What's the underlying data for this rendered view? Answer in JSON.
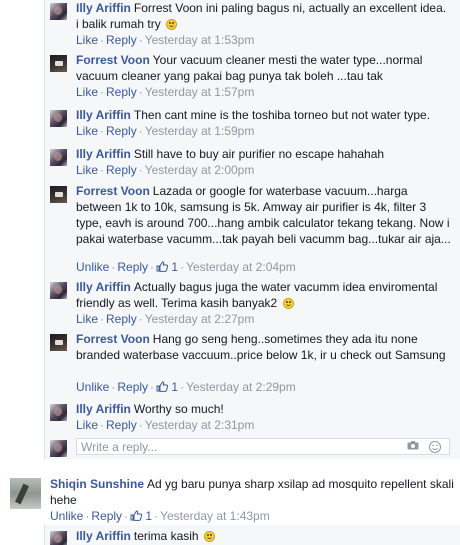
{
  "labels": {
    "like": "Like",
    "unlike": "Unlike",
    "reply": "Reply",
    "sep": "·",
    "write_placeholder": "Write a reply..."
  },
  "replies": [
    {
      "author": "Illy Ariffin",
      "text": "Forrest Voon ini paling bagus ni, actually an excellent idea. i balik rumah try",
      "emoji": "smile",
      "action": "Like",
      "likes": "",
      "time": "Yesterday at 1:53pm"
    },
    {
      "author": "Forrest Voon",
      "text": "Your vacuum cleaner mesti the water type...normal vacuum cleaner yang pakai bag punya tak boleh ...tau tak",
      "action": "Like",
      "likes": "",
      "time": "Yesterday at 1:57pm"
    },
    {
      "author": "Illy Ariffin",
      "text": "Then cant mine is the toshiba torneo but not water type.",
      "action": "Like",
      "likes": "",
      "time": "Yesterday at 1:59pm"
    },
    {
      "author": "Illy Ariffin",
      "text": "Still have to buy air purifier no escape hahahah",
      "action": "Like",
      "likes": "",
      "time": "Yesterday at 2:00pm"
    },
    {
      "author": "Forrest Voon",
      "text": "Lazada or google for waterbase vacuum...harga between 1k to 10k, samsung is 5k. Amway air purifier is 4k, filter 3 type, eavh is around 700...hang ambik calculator tekang tekang. Now i pakai waterbase vacumm...tak payah beli vacumm bag...tukar air aja...",
      "action": "Unlike",
      "likes": "1",
      "time": "Yesterday at 2:04pm"
    },
    {
      "author": "Illy Ariffin",
      "text": "Actually bagus juga the water vacumm idea enviromental friendly as well. Terima kasih banyak2",
      "emoji": "smile",
      "action": "Like",
      "likes": "",
      "time": "Yesterday at 2:27pm"
    },
    {
      "author": "Forrest Voon",
      "text": "Hang go seng heng..sometimes they ada itu none branded waterbase vaccuum..price below 1k, ir u check out Samsung",
      "action": "Unlike",
      "likes": "1",
      "time": "Yesterday at 2:29pm"
    },
    {
      "author": "Illy Ariffin",
      "text": "Worthy so much!",
      "action": "Like",
      "likes": "",
      "time": "Yesterday at 2:31pm"
    }
  ],
  "top_comments": [
    {
      "author": "Shiqin Sunshine",
      "text": "Ad yg baru punya sharp xsilap ad mosquito repellent skali hehe",
      "action": "Unlike",
      "likes": "1",
      "time": "Yesterday at 1:43pm"
    }
  ],
  "last_reply": {
    "author": "Illy Ariffin",
    "text": "terima kasih",
    "emoji": "smile"
  },
  "colors": {
    "link": "#3b5998",
    "meta": "#9197a3",
    "reply_bg": "#f6f7f8"
  }
}
